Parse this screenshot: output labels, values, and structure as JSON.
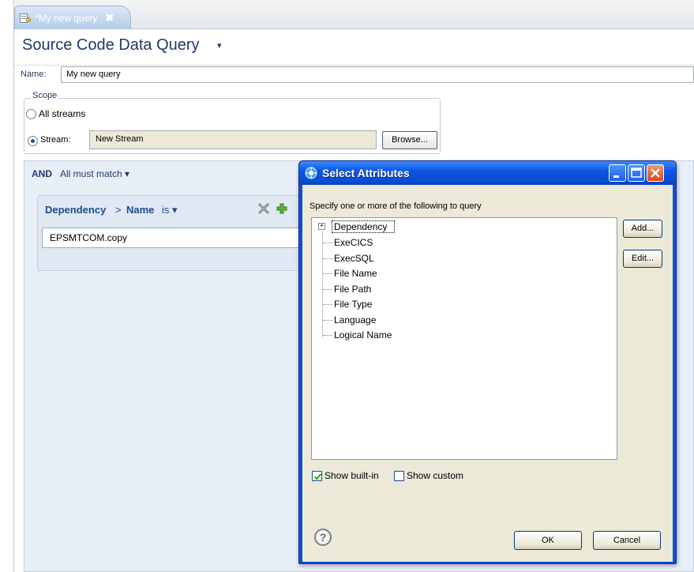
{
  "editor": {
    "tab": {
      "label": "*My new query",
      "close_glyph": "✖",
      "icon": "query-file-icon"
    },
    "title": "Source Code Data Query",
    "title_caret": "▾",
    "name_label": "Name:",
    "name_value": "My new query",
    "scope": {
      "legend": "Scope",
      "all_streams_label": "All streams",
      "stream_label": "Stream:",
      "stream_value": "New Stream",
      "browse_label": "Browse...",
      "selected": "stream"
    },
    "query": {
      "and_label": "AND",
      "match_label": "All must match ▾",
      "condition": {
        "attribute": "Dependency",
        "separator": ">",
        "field": "Name",
        "operator": "is ▾",
        "value": "EPSMTCOM.copy"
      }
    }
  },
  "dialog": {
    "title": "Select Attributes",
    "prompt": "Specify one or more of the following to query",
    "tree": [
      "Dependency",
      "ExeCICS",
      "ExecSQL",
      "File Name",
      "File Path",
      "File Type",
      "Language",
      "Logical Name"
    ],
    "expander_glyph": "+",
    "add_label": "Add...",
    "edit_label": "Edit...",
    "show_builtin_label": "Show built-in",
    "show_builtin_checked": true,
    "show_custom_label": "Show custom",
    "show_custom_checked": false,
    "help_glyph": "?",
    "ok_label": "OK",
    "cancel_label": "Cancel"
  },
  "colors": {
    "title_blue": "#1f3a66",
    "dialog_titlebar": "#0a4bd3",
    "dialog_body": "#ece9d8",
    "close_red": "#d9451c"
  }
}
